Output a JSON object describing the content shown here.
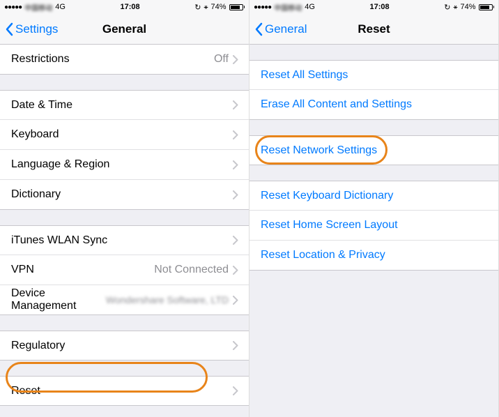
{
  "statusbar": {
    "carrier_blur": "中国移动",
    "network": "4G",
    "time": "17:08",
    "battery_pct": "74%"
  },
  "left": {
    "back": "Settings",
    "title": "General",
    "rows": {
      "restrictions": {
        "label": "Restrictions",
        "value": "Off"
      },
      "datetime": {
        "label": "Date & Time"
      },
      "keyboard": {
        "label": "Keyboard"
      },
      "langregion": {
        "label": "Language & Region"
      },
      "dictionary": {
        "label": "Dictionary"
      },
      "ituneswlan": {
        "label": "iTunes WLAN Sync"
      },
      "vpn": {
        "label": "VPN",
        "value": "Not Connected"
      },
      "devicemgmt": {
        "label": "Device Management",
        "value": "Wondershare Software, LTD"
      },
      "regulatory": {
        "label": "Regulatory"
      },
      "reset": {
        "label": "Reset"
      }
    }
  },
  "right": {
    "back": "General",
    "title": "Reset",
    "rows": {
      "reset_all": "Reset All Settings",
      "erase_all": "Erase All Content and Settings",
      "reset_network": "Reset Network Settings",
      "reset_keyboard": "Reset Keyboard Dictionary",
      "reset_homescreen": "Reset Home Screen Layout",
      "reset_location": "Reset Location & Privacy"
    }
  }
}
